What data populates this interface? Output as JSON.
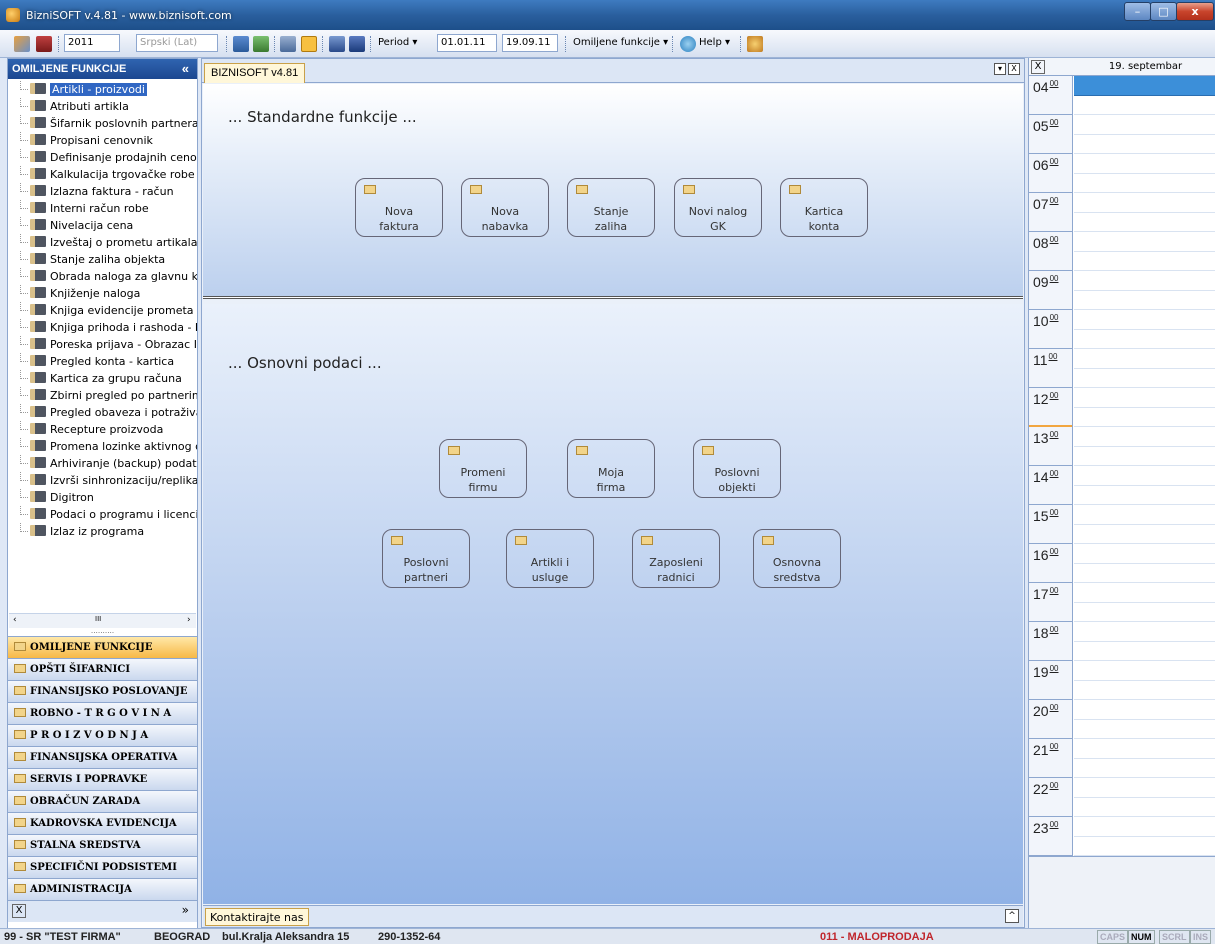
{
  "window": {
    "title": "BizniSOFT v.4.81 - www.biznisoft.com",
    "minimize": "–",
    "maximize": "□",
    "close": "x"
  },
  "toolbar": {
    "year": "2011",
    "language": "Srpski (Lat)",
    "period_label": "Period ▾",
    "date_from": "01.01.11",
    "date_to": "19.09.11",
    "favorites_label": "Omiljene funkcije ▾",
    "help_label": "Help ▾"
  },
  "sidebar": {
    "title": "OMILJENE FUNKCIJE",
    "collapse": "«",
    "items": [
      "Artikli - proizvodi",
      "Atributi artikla",
      "Šifarnik poslovnih partnera",
      "Propisani cenovnik",
      "Definisanje prodajnih cenov",
      "Kalkulacija trgovačke robe",
      "Izlazna faktura - račun",
      "Interni račun robe",
      "Nivelacija cena",
      "Izveštaj o prometu artikala",
      "Stanje zaliha objekta",
      "Obrada naloga za glavnu kı",
      "Knjiženje naloga",
      "Knjiga evidencije prometa i",
      "Knjiga prihoda i rashoda - I",
      "Poreska prijava - Obrazac I",
      "Pregled konta - kartica",
      "Kartica za grupu računa",
      "Zbirni pregled po partnerim",
      "Pregled obaveza i potraživa",
      "Recepture proizvoda",
      "Promena lozinke aktivnog c",
      "Arhiviranje (backup) podata",
      "Izvrši sinhronizaciju/replika",
      "Digitron",
      "Podaci o programu i licenci",
      "Izlaz iz programa"
    ],
    "scroll": {
      "left": "‹",
      "thumb": "III",
      "right": "›"
    },
    "grip": "……….",
    "categories": [
      "OMILJENE FUNKCIJE",
      "OPŠTI ŠIFARNICI",
      "FINANSIJSKO POSLOVANJE",
      "ROBNO - T R G O V I N A",
      "P R O I Z V O D N J A",
      "FINANSIJSKA OPERATIVA",
      "SERVIS I POPRAVKE",
      "OBRAČUN ZARADA",
      "KADROVSKA EVIDENCIJA",
      "STALNA SREDSTVA",
      "SPECIFIČNI PODSISTEMI",
      "ADMINISTRACIJA"
    ],
    "footer_close": "X",
    "footer_more": "»"
  },
  "main": {
    "tab": "BIZNISOFT v4.81",
    "section_standard": "... Standardne funkcije ...",
    "standard_buttons": [
      "Nova\nfaktura",
      "Nova\nnabavka",
      "Stanje\nzaliha",
      "Novi  nalog\nGK",
      "Kartica\nkonta"
    ],
    "section_basic": "... Osnovni podaci ...",
    "basic_buttons_row1": [
      "Promeni\nfirmu",
      "Moja\nfirma",
      "Poslovni\nobjekti"
    ],
    "basic_buttons_row2": [
      "Poslovni\npartneri",
      "Artikli i\nusluge",
      "Zaposleni\nradnici",
      "Osnovna\nsredstva"
    ],
    "contact": "Kontaktirajte nas",
    "menu_btn": "▾",
    "close_btn": "X",
    "up_btn": "^"
  },
  "calendar": {
    "close": "X",
    "date": "19. septembar",
    "minutes": "00",
    "hours": [
      "04",
      "05",
      "06",
      "07",
      "08",
      "09",
      "10",
      "11",
      "12",
      "13",
      "14",
      "15",
      "16",
      "17",
      "18",
      "19",
      "20",
      "21",
      "22",
      "23"
    ]
  },
  "status": {
    "company": "99 - SR \"TEST FIRMA\"",
    "city": "BEOGRAD",
    "address": "bul.Kralja Aleksandra 15",
    "phone": "290-1352-64",
    "store": "011 - MALOPRODAJA",
    "keys": [
      "CAPS",
      "NUM",
      "SCRL",
      "INS"
    ],
    "store_color": "#c0262c"
  }
}
